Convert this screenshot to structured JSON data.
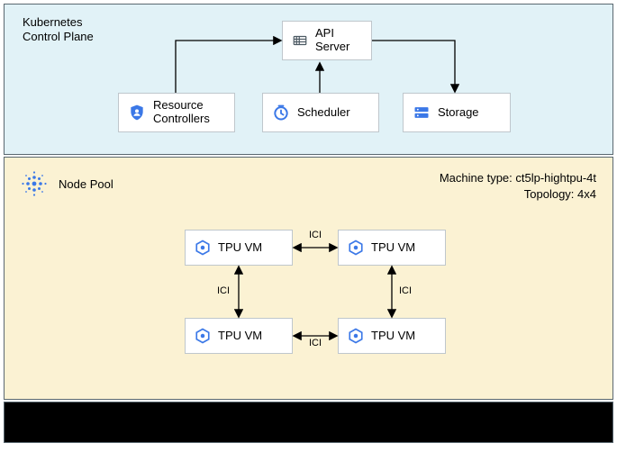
{
  "control_plane": {
    "title_line1": "Kubernetes",
    "title_line2": "Control Plane",
    "api_line1": "API",
    "api_line2": "Server",
    "rc_line1": "Resource",
    "rc_line2": "Controllers",
    "scheduler": "Scheduler",
    "storage": "Storage"
  },
  "node_pool": {
    "title": "Node Pool",
    "machine_type_label": "Machine type: ct5lp-hightpu-4t",
    "topology_label": "Topology: 4x4",
    "tpu_label": "TPU VM",
    "ici_label": "ICI"
  }
}
